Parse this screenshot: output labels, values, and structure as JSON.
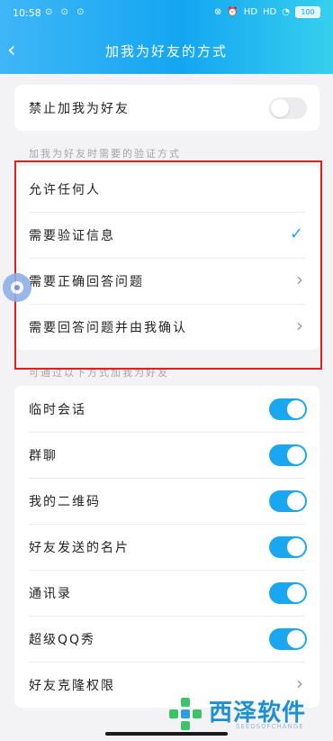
{
  "status_bar": {
    "time": "10:58",
    "left_icons": "⊙ ⊙ ⊙",
    "signal_1": "HD",
    "signal_2": "HD",
    "battery": "100"
  },
  "nav": {
    "back_icon": "chevron-left-icon",
    "title": "加我为好友的方式"
  },
  "block_section": {
    "label": "禁止加我为好友",
    "toggle_on": false
  },
  "verify_section": {
    "header": "加我为好友时需要的验证方式",
    "options": [
      {
        "label": "允许任何人",
        "indicator": "none"
      },
      {
        "label": "需要验证信息",
        "indicator": "check"
      },
      {
        "label": "需要正确回答问题",
        "indicator": "chevron"
      },
      {
        "label": "需要回答问题并由我确认",
        "indicator": "chevron"
      }
    ]
  },
  "sources_section": {
    "header": "可通过以下方式加我为好友",
    "items": [
      {
        "label": "临时会话",
        "toggle_on": true
      },
      {
        "label": "群聊",
        "toggle_on": true
      },
      {
        "label": "我的二维码",
        "toggle_on": true
      },
      {
        "label": "好友发送的名片",
        "toggle_on": true
      },
      {
        "label": "通讯录",
        "toggle_on": true
      },
      {
        "label": "超级QQ秀",
        "toggle_on": true
      },
      {
        "label": "好友克隆权限",
        "toggle_on": null
      }
    ]
  },
  "colors": {
    "accent": "#1ba6f1",
    "highlight_box": "#e02020",
    "header_gradient": [
      "#3fb6f7",
      "#36d0ee"
    ]
  },
  "watermark": {
    "text": "西泽软件",
    "subtext": "SEEDSOFCHANGE"
  }
}
